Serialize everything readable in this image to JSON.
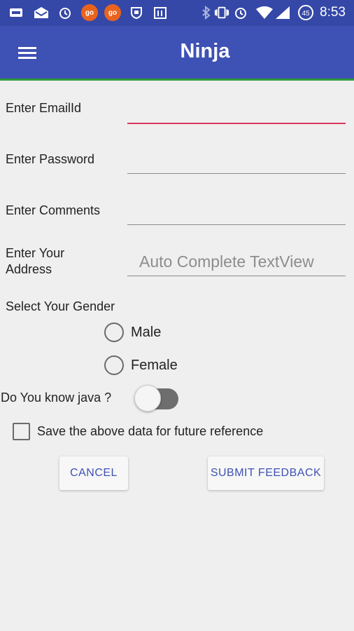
{
  "status_bar": {
    "icons_left": [
      "sim-card-icon",
      "mail-icon",
      "alarm-icon",
      "go-badge-icon",
      "go-badge-icon",
      "shield-icon",
      "building-icon"
    ],
    "go_label": "go",
    "icons_right": [
      "bluetooth-icon",
      "vibrate-icon",
      "alarm-icon",
      "wifi-icon",
      "signal-icon",
      "battery-icon"
    ],
    "battery_level": "45",
    "time": "8:53"
  },
  "app_bar": {
    "title": "Ninja",
    "menu_icon": "hamburger-menu-icon"
  },
  "form": {
    "email_label": "Enter EmailId",
    "email_value": "",
    "password_label": "Enter Password",
    "password_value": "",
    "comments_label": "Enter Comments",
    "comments_value": "",
    "address_label": "Enter Your Address",
    "address_placeholder": "Auto Complete TextView",
    "gender_label": "Select Your Gender",
    "gender_options": [
      "Male",
      "Female"
    ],
    "java_label": "Do You know java ?",
    "java_enabled": false,
    "save_label": "Save the above data for future reference",
    "save_checked": false
  },
  "buttons": {
    "cancel": "CANCEL",
    "submit": "SUBMIT FEEDBACK"
  },
  "colors": {
    "status_bar": "#3548a8",
    "app_bar": "#3e51b4",
    "accent_underline": "#d9385e",
    "button_text": "#3e51b4"
  }
}
